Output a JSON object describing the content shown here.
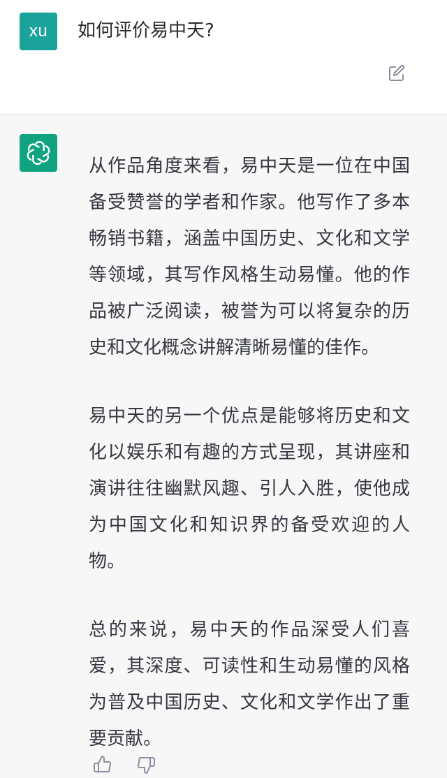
{
  "user": {
    "avatar_text": "xu",
    "message": "如何评价易中天?",
    "avatar_color": "#1aa39b"
  },
  "assistant": {
    "avatar_color": "#10a37f",
    "paragraphs": [
      "从作品角度来看，易中天是一位在中国备受赞誉的学者和作家。他写作了多本畅销书籍，涵盖中国历史、文化和文学等领域，其写作风格生动易懂。他的作品被广泛阅读，被誉为可以将复杂的历史和文化概念讲解清晰易懂的佳作。",
      "易中天的另一个优点是能够将历史和文化以娱乐和有趣的方式呈现，其讲座和演讲往往幽默风趣、引人入胜，使他成为中国文化和知识界的备受欢迎的人物。",
      "总的来说，易中天的作品深受人们喜爱，其深度、可读性和生动易懂的风格为普及中国历史、文化和文学作出了重要贡献。"
    ]
  },
  "icons": {
    "edit": "edit-icon",
    "thumbs_up": "thumbs-up-icon",
    "thumbs_down": "thumbs-down-icon",
    "assistant_logo": "openai-logo-icon"
  }
}
